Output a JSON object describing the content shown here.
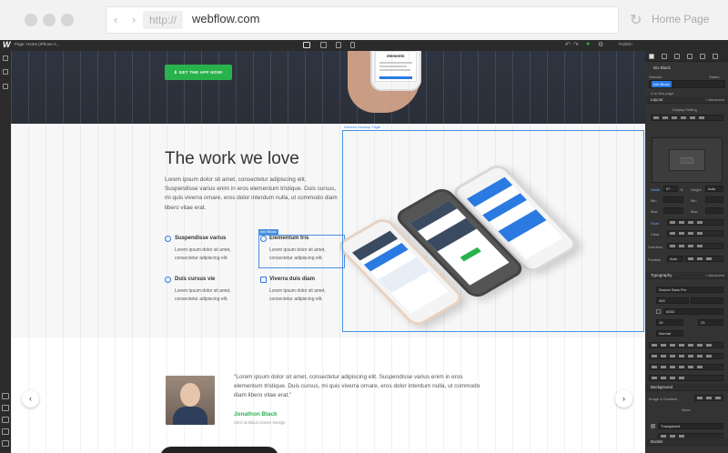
{
  "browser": {
    "protocol": "http://",
    "domain": "webflow.com",
    "home_label": "Home Page",
    "nav": "‹ ›",
    "reload_icon": "↻"
  },
  "toolbar": {
    "logo": "W",
    "page_label": "Page: Home (iPhone A...",
    "publish_label": "Publish",
    "icons": [
      "undo-icon",
      "redo-icon",
      "preview-icon",
      "settings-icon"
    ]
  },
  "hero": {
    "app_button": "⬇  GET THE APP NOW!",
    "phone_title": "elements"
  },
  "work": {
    "heading": "The work we love",
    "paragraph": "Lorem ipsum dolor sit amet, consectetur adipiscing elit. Suspendisse varius enim in eros elementum tristique. Duis cursus, mi quis viverra ornare, eros dolor interdum nulla, ut commodo diam libero vitae erat.",
    "features": [
      {
        "title": "Suspendisse varius",
        "text": "Lorem ipsum dolor sit amet, consectetur adipiscing elit."
      },
      {
        "title": "Elementum tris",
        "text": "Lorem ipsum dolor sit amet, consectetur adipiscing elit."
      },
      {
        "title": "Duis cursus vie",
        "text": "Lorem ipsum dolor sit amet, consectetur adipiscing elit."
      },
      {
        "title": "Viverra duis diam",
        "text": "Lorem ipsum dolor sit amet, consectetur adipiscing elit."
      }
    ],
    "selection_label": "Devices Mockup Flight",
    "info_label": "Info Block"
  },
  "testimonial": {
    "quote": "\"Lorem ipsum dolor sit amet, consectetur adipiscing elit. Suspendisse varius enim in eros elementum tristique. Duis cursus, mi quis viverra ornare, eros dolor interdum nulla, ut commodo diam libero vitae erat.\"",
    "name": "Jonathon Black",
    "role": "CEO at Black Dunes Design",
    "prev": "‹",
    "next": "›"
  },
  "panel": {
    "element_name": "Div Block",
    "selector_label": "Selector",
    "states_label": "States",
    "selector_chip": "Info Block",
    "on_page": "4 on this page",
    "layout_title": "Layout",
    "advanced": "+ Advanced",
    "display_label": "Display Setting",
    "width_label": "Width",
    "width_value": "97",
    "width_unit": "%",
    "height_label": "Height",
    "height_value": "Auto",
    "min_label": "Min",
    "max_label": "Max",
    "float_label": "Float",
    "clear_label": "Clear",
    "overflow_label": "Overflow",
    "position_label": "Position",
    "position_value": "Auto",
    "typography_title": "Typography",
    "font_value": "Source Sans Pro",
    "weight_value": "400",
    "color_value": "#333",
    "size_value": "15",
    "line_value": "23",
    "style_value": "Normal",
    "background_title": "Background",
    "image_label": "Image & Gradient",
    "none_label": "None",
    "bg_color": "Transparent",
    "border_title": "Border"
  }
}
